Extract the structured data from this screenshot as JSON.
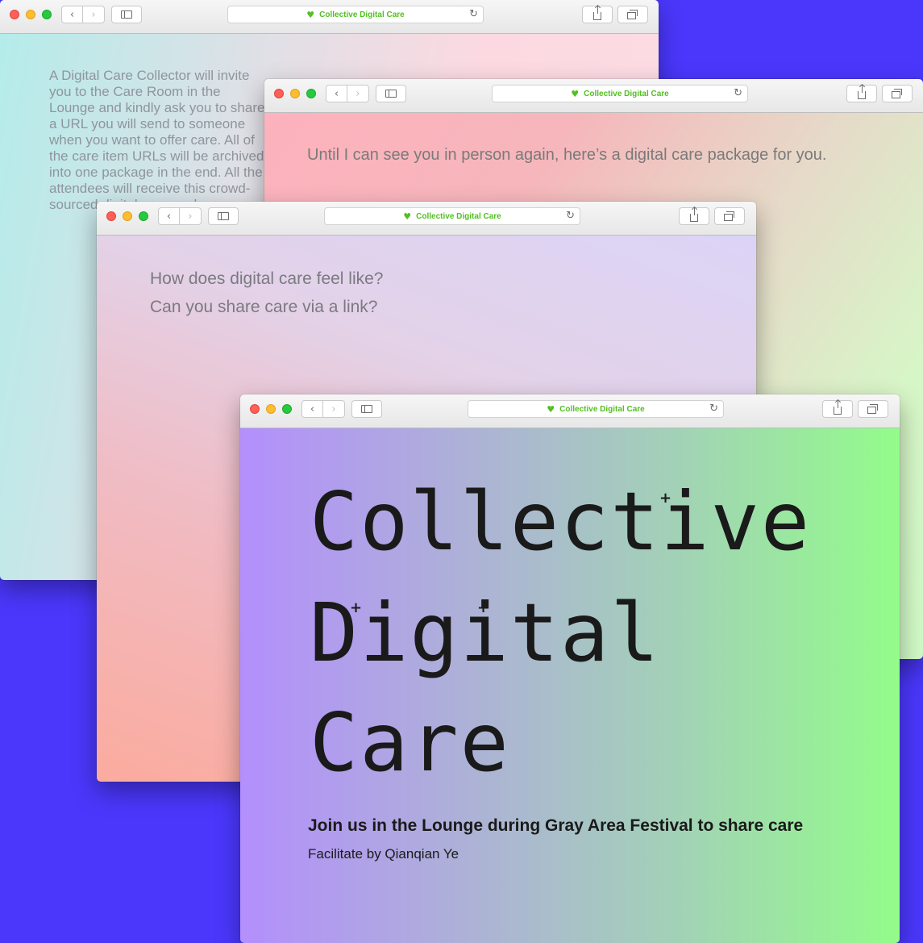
{
  "colors": {
    "desktop_bg": "#4a37fb",
    "url_accent": "#52c01f"
  },
  "browser": {
    "tab_title": "Collective Digital Care",
    "heart_icon": "heart-icon",
    "back_glyph": "‹",
    "forward_glyph": "›",
    "reload_glyph": "↻"
  },
  "windows": {
    "w1": {
      "text": "A Digital Care Collector will invite you to the Care Room in the Lounge and kindly ask you to share a URL you will send to someone when you want to offer care. All of the care item URLs will be archived into one package in the end. All the attendees will receive this crowd-sourced digital care package."
    },
    "w2": {
      "text": "Until I can see you in person again, here’s a digital care package for you."
    },
    "w3": {
      "questions": [
        "How does digital care feel like?",
        "Can you share care via a link?"
      ]
    },
    "w4": {
      "title_lines": [
        "Collective",
        "Digital",
        "Care"
      ],
      "tagline": "Join us in the Lounge during Gray Area Festival to share care",
      "credit": "Facilitate by Qianqian Ye"
    }
  }
}
